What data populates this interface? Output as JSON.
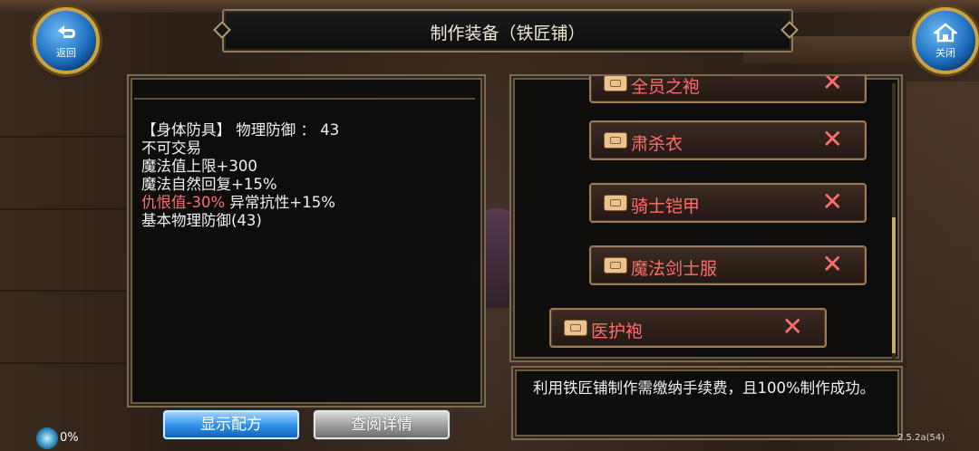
{
  "title": "制作装备（铁匠铺）",
  "nav": {
    "back_label": "返回",
    "close_label": "关闭"
  },
  "item_info": {
    "line1": "【身体防具】 物理防御 ：  43",
    "line2": "不可交易",
    "line3": "魔法值上限+300",
    "line4": "魔法自然回复+15%",
    "line5_red": "仇恨值-30%",
    "line5_rest": " 异常抗性+15%",
    "line6": "基本物理防御(43)"
  },
  "recipes": [
    {
      "name": "全员之袍",
      "icon": "scroll-icon",
      "remove": "✕"
    },
    {
      "name": "肃杀衣",
      "icon": "scroll-icon",
      "remove": "✕"
    },
    {
      "name": "骑士铠甲",
      "icon": "scroll-icon",
      "remove": "✕"
    },
    {
      "name": "魔法剑士服",
      "icon": "scroll-icon",
      "remove": "✕"
    },
    {
      "name": "医护袍",
      "icon": "scroll-icon",
      "remove": "✕"
    }
  ],
  "notice": "利用铁匠铺制作需缴纳手续费，且100%制作成功。",
  "buttons": {
    "show_recipe": "显示配方",
    "view_detail": "查阅详情"
  },
  "status": {
    "percent": "0%",
    "version": "2.5.2a(54)"
  },
  "colors": {
    "red_text": "#ff6e6e",
    "accent_blue": "#2d8fe6",
    "frame_gold": "#c9a344"
  }
}
